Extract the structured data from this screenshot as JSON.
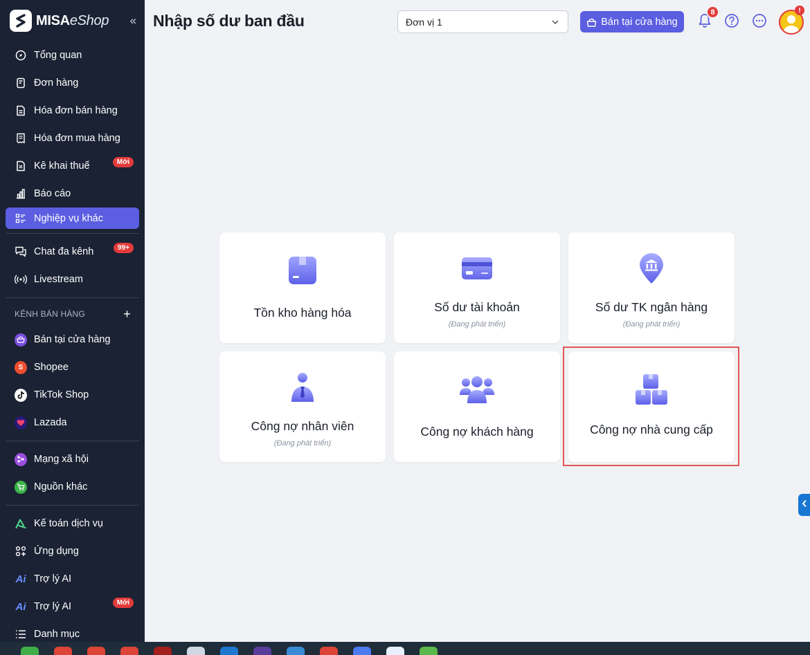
{
  "brand": {
    "name_bold": "MISA",
    "name_rest": "eShop"
  },
  "sidebar": {
    "items": [
      {
        "label": "Tổng quan",
        "icon": "dashboard-icon"
      },
      {
        "label": "Đơn hàng",
        "icon": "order-icon"
      },
      {
        "label": "Hóa đơn bán hàng",
        "icon": "sales-invoice-icon"
      },
      {
        "label": "Hóa đơn mua hàng",
        "icon": "purchase-invoice-icon"
      },
      {
        "label": "Kê khai thuế",
        "icon": "tax-icon",
        "badge": "Mới"
      },
      {
        "label": "Báo cáo",
        "icon": "report-icon"
      },
      {
        "label": "Nghiệp vụ khác",
        "icon": "list-icon",
        "active": true
      }
    ],
    "items2": [
      {
        "label": "Chat đa kênh",
        "icon": "chat-icon",
        "badge": "99+"
      },
      {
        "label": "Livestream",
        "icon": "livestream-icon"
      }
    ],
    "channels_title": "KÊNH BÁN HÀNG",
    "channels": [
      {
        "label": "Bán tại cửa hàng",
        "color": "#7b4fe0"
      },
      {
        "label": "Shopee",
        "color": "#ee4d2d"
      },
      {
        "label": "TikTok Shop",
        "color": "#000000"
      },
      {
        "label": "Lazada",
        "color": "#2a1a7a"
      }
    ],
    "social": [
      {
        "label": "Mạng xã hội",
        "color": "#9b4fe0"
      },
      {
        "label": "Nguồn khác",
        "color": "#3bb54a"
      }
    ],
    "tools": [
      {
        "label": "Kế toán dịch vụ",
        "icon": "accounting-icon"
      },
      {
        "label": "Ứng dụng",
        "icon": "apps-icon"
      },
      {
        "label": "Trợ lý AI",
        "icon": "ai-icon"
      },
      {
        "label": "Trợ lý AI",
        "icon": "ai-icon",
        "badge": "Mới"
      },
      {
        "label": "Danh mục",
        "icon": "catalog-icon"
      }
    ]
  },
  "header": {
    "title": "Nhập số dư ban đầu",
    "unit_select": "Đơn vị 1",
    "store_button": "Bán tại cửa hàng",
    "notification_count": "8",
    "avatar_alert": "!"
  },
  "cards": [
    {
      "title": "Tồn kho hàng hóa",
      "subtitle": "",
      "icon": "inventory-box-icon"
    },
    {
      "title": "Số dư tài khoản",
      "subtitle": "(Đang phát triển)",
      "icon": "credit-card-icon"
    },
    {
      "title": "Số dư TK ngân hàng",
      "subtitle": "(Đang phát triển)",
      "icon": "bank-pin-icon"
    },
    {
      "title": "Công nợ nhân viên",
      "subtitle": "(Đang phát triển)",
      "icon": "employee-icon"
    },
    {
      "title": "Công nợ khách hàng",
      "subtitle": "",
      "icon": "customers-icon"
    },
    {
      "title": "Công nợ nhà cung cấp",
      "subtitle": "",
      "icon": "supplier-boxes-icon"
    }
  ],
  "colors": {
    "accent": "#5b5ee0",
    "sidebar_bg": "#1a2233",
    "highlight": "#e05555"
  }
}
